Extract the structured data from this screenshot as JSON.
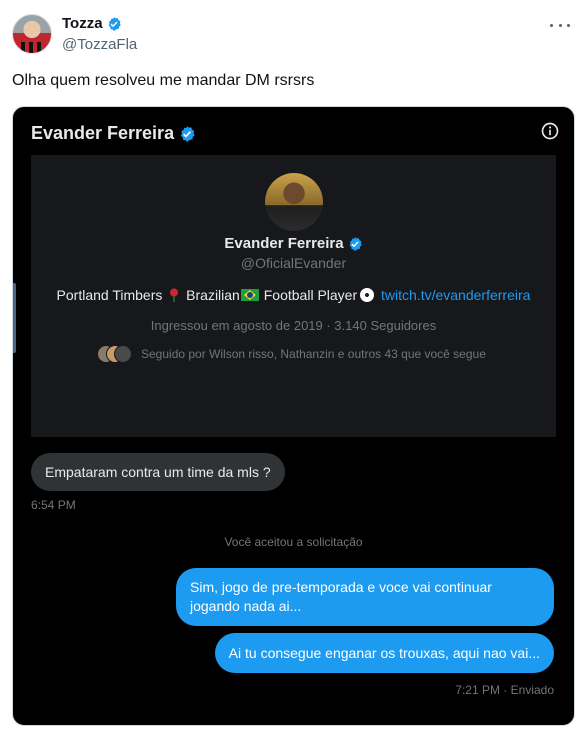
{
  "tweet": {
    "author_name": "Tozza",
    "handle": "@TozzaFla",
    "text": "Olha quem resolveu me mandar DM rsrsrs"
  },
  "dm": {
    "contact_name": "Evander Ferreira",
    "profile": {
      "name": "Evander Ferreira",
      "handle": "@OficialEvander",
      "bio_part1": "Portland Timbers",
      "bio_part2": "Brazilian",
      "bio_part3": "Football Player",
      "bio_link": "twitch.tv/evanderferreira",
      "joined": "Ingressou em agosto de 2019 · 3.140 Seguidores",
      "followed_by": "Seguido por Wilson risso, Nathanzin e outros 43 que você segue"
    },
    "messages": {
      "incoming_text": "Empataram contra um time da mls ?",
      "incoming_time": "6:54 PM",
      "system_text": "Você aceitou a solicitação",
      "outgoing_1": "Sim, jogo de pre-temporada e voce vai continuar jogando nada ai...",
      "outgoing_2": "Ai tu consegue enganar os trouxas, aqui nao vai...",
      "outgoing_time": "7:21 PM · Enviado"
    }
  },
  "colors": {
    "accent_blue": "#1d9bf0",
    "dark_bg": "#000000",
    "card_bg": "#16181c",
    "bubble_gray": "#2f3336"
  },
  "icons": [
    "verified-badge-icon",
    "more-icon",
    "info-icon",
    "rose-emoji-icon",
    "brazil-flag-icon",
    "soccer-ball-icon"
  ]
}
